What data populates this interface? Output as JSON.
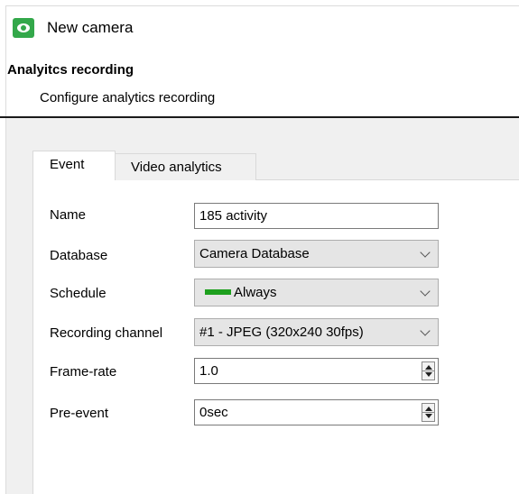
{
  "window": {
    "title": "New camera"
  },
  "section": {
    "title": "Analyitcs recording",
    "subtitle": "Configure analytics recording"
  },
  "tabs": [
    {
      "label": "Event",
      "active": true
    },
    {
      "label": "Video analytics",
      "active": false
    }
  ],
  "form": {
    "name": {
      "label": "Name",
      "value": "185 activity"
    },
    "database": {
      "label": "Database",
      "value": "Camera Database"
    },
    "schedule": {
      "label": "Schedule",
      "value": "Always",
      "color": "#1ea01e"
    },
    "recording_channel": {
      "label": "Recording channel",
      "value": "#1 - JPEG (320x240 30fps)"
    },
    "frame_rate": {
      "label": "Frame-rate",
      "value": "1.0"
    },
    "pre_event": {
      "label": "Pre-event",
      "value": "0sec"
    }
  },
  "icons": {
    "app": "camera-eye-icon",
    "dropdown": "chevron-down-icon",
    "spinner": "spin-arrows-icon"
  }
}
